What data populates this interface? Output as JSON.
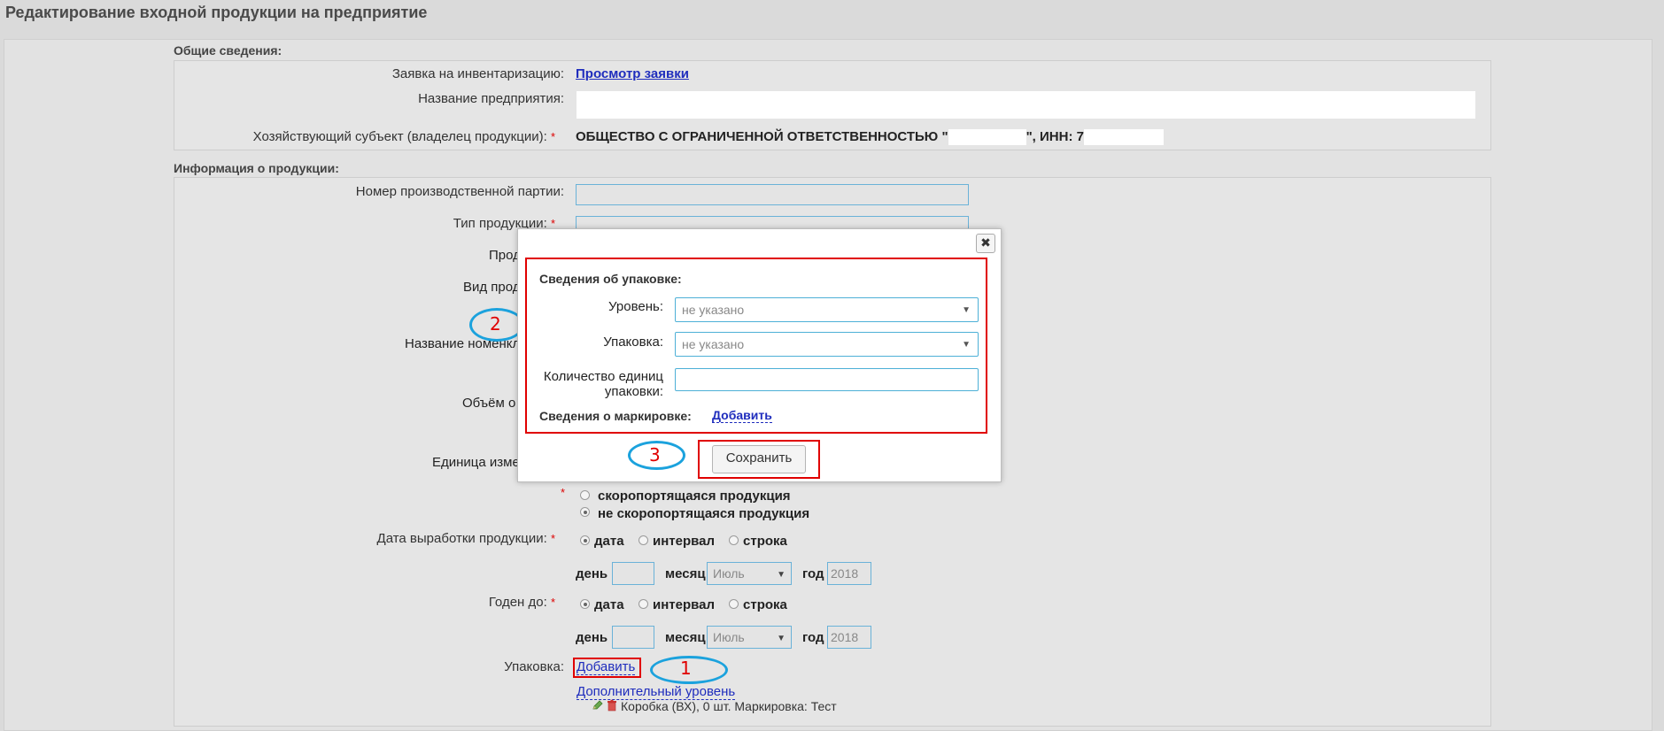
{
  "page": {
    "title": "Редактирование входной продукции на предприятие"
  },
  "general": {
    "heading": "Общие сведения:",
    "request_label": "Заявка на инвентаризацию:",
    "request_link": "Просмотр заявки",
    "enterprise_label": "Название предприятия:",
    "enterprise_value": "",
    "owner_label": "Хозяйствующий субъект (владелец продукции):",
    "owner_value": "ОБЩЕСТВО С ОГРАНИЧЕННОЙ ОТВЕТСТВЕННОСТЬЮ \"",
    "owner_inn_label": "\", ИНН:",
    "owner_inn_prefix": "7"
  },
  "product": {
    "heading": "Информация о продукции:",
    "batch_label": "Номер производственной партии:",
    "batch_value": "",
    "type_label": "Тип продукции:",
    "product_label_partial": "Прод",
    "kind_label_partial": "Вид прод",
    "nomenclature_label_partial": "Название номенкл",
    "volume_label_partial": "Объём о",
    "unit_label_partial": "Единица изме",
    "perishable_options": [
      "скоропортящаяся продукция",
      "не скоропортящаяся продукция"
    ],
    "production_date_label": "Дата выработки продукции:",
    "expiry_label": "Годен до:",
    "date_modes": [
      "дата",
      "интервал",
      "строка"
    ],
    "day_label": "день",
    "month_label": "месяц",
    "year_label": "год",
    "month_value": "Июль",
    "year_value": "2018",
    "packaging_label": "Упаковка:",
    "add_link": "Добавить",
    "extra_level_link": "Дополнительный уровень",
    "package_item": "Коробка (ВХ), 0 шт. Маркировка: Тест"
  },
  "dialog": {
    "close_symbol": "✖",
    "packaging_heading": "Сведения об упаковке:",
    "level_label": "Уровень:",
    "level_value": "не указано",
    "package_label": "Упаковка:",
    "package_value": "не указано",
    "quantity_label": "Количество единиц упаковки:",
    "quantity_value": "",
    "marking_label": "Сведения о маркировке:",
    "marking_add_link": "Добавить",
    "save_button": "Сохранить"
  },
  "annotations": {
    "one": "1",
    "two": "2",
    "three": "3"
  },
  "colors": {
    "annotation_red": "#e00000",
    "annotation_blue": "#1ba2dd",
    "link_blue": "#1f2dbd"
  }
}
